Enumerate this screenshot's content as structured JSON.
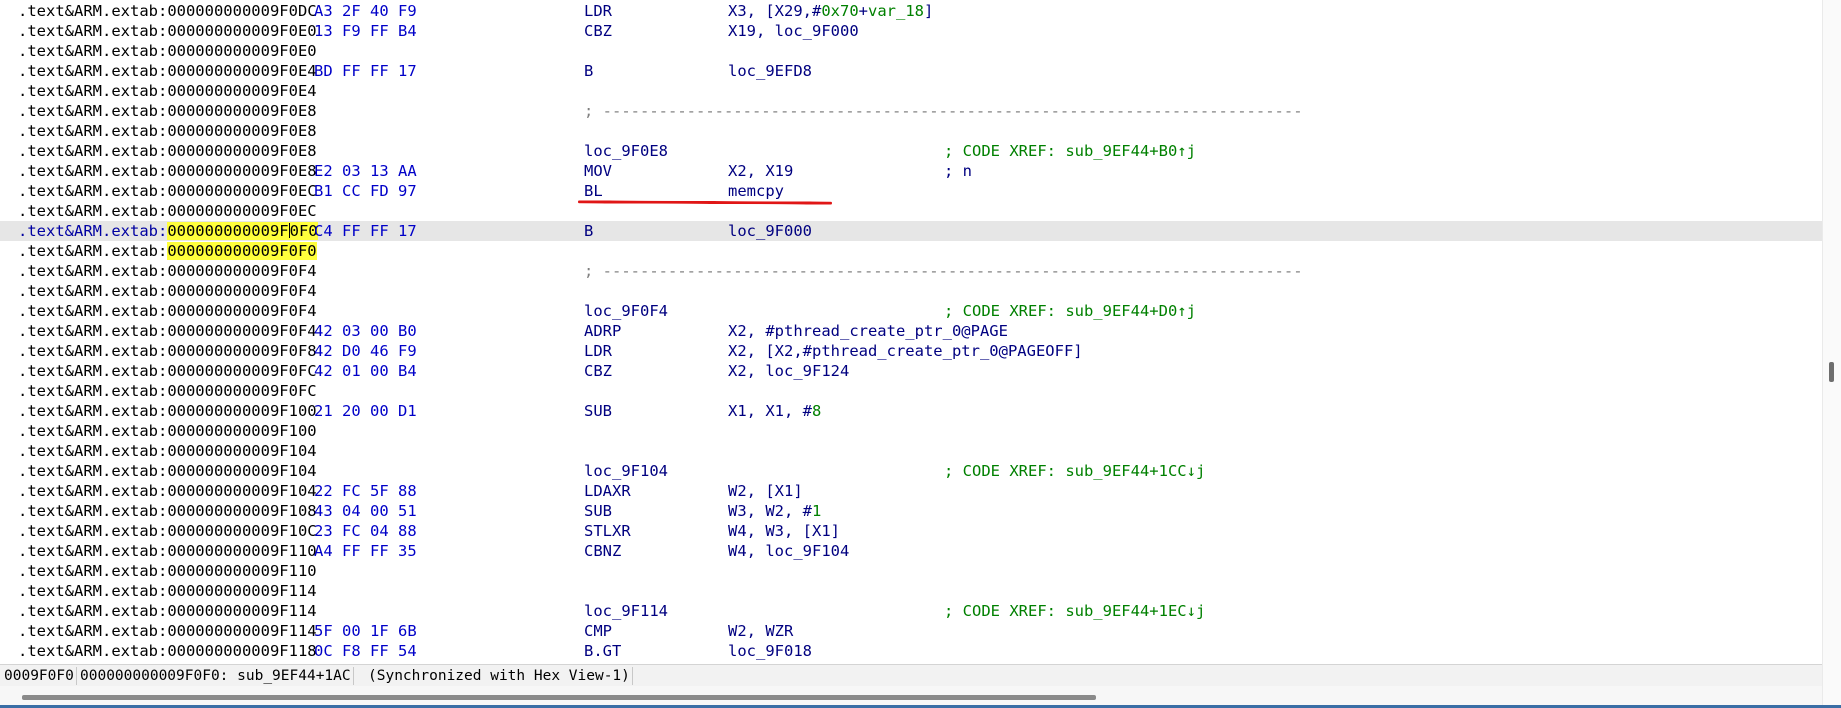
{
  "rows": [
    {
      "seg": ".text&ARM.extab:",
      "addr": "000000000009F0DC",
      "bytes": "A3 2F 40 F9",
      "mnem": "LDR",
      "ops": [
        "X3, [X29,#",
        "0x70",
        "+",
        "var_18",
        "]"
      ],
      "opsKinds": [
        "t",
        "n",
        "t",
        "n",
        "t"
      ],
      "cmt": ""
    },
    {
      "seg": ".text&ARM.extab:",
      "addr": "000000000009F0E0",
      "bytes": "13 F9 FF B4",
      "mnem": "CBZ",
      "ops": [
        "X19, loc_9F000"
      ],
      "opsKinds": [
        "t"
      ],
      "cmt": ""
    },
    {
      "seg": ".text&ARM.extab:",
      "addr": "000000000009F0E0",
      "bytes": "",
      "mnem": "",
      "ops": [],
      "opsKinds": [],
      "cmt": ""
    },
    {
      "seg": ".text&ARM.extab:",
      "addr": "000000000009F0E4",
      "bytes": "BD FF FF 17",
      "mnem": "B",
      "ops": [
        "loc_9EFD8"
      ],
      "opsKinds": [
        "t"
      ],
      "cmt": ""
    },
    {
      "seg": ".text&ARM.extab:",
      "addr": "000000000009F0E4",
      "bytes": "",
      "mnem": "",
      "ops": [],
      "opsKinds": [],
      "cmt": ""
    },
    {
      "seg": ".text&ARM.extab:",
      "addr": "000000000009F0E8",
      "bytes": "",
      "sep": "; ---------------------------------------------------------------------------",
      "mnem": "",
      "ops": [],
      "opsKinds": [],
      "cmt": ""
    },
    {
      "seg": ".text&ARM.extab:",
      "addr": "000000000009F0E8",
      "bytes": "",
      "mnem": "",
      "ops": [],
      "opsKinds": [],
      "cmt": ""
    },
    {
      "seg": ".text&ARM.extab:",
      "addr": "000000000009F0E8",
      "bytes": "",
      "mnem": "loc_9F0E8",
      "ops": [],
      "opsKinds": [],
      "cmt": "; CODE XREF: sub_9EF44+B0↑j"
    },
    {
      "seg": ".text&ARM.extab:",
      "addr": "000000000009F0E8",
      "bytes": "E2 03 13 AA",
      "mnem": "MOV",
      "ops": [
        "X2, X19"
      ],
      "opsKinds": [
        "t"
      ],
      "cmt": "; n",
      "cmtBlue": true
    },
    {
      "seg": ".text&ARM.extab:",
      "addr": "000000000009F0EC",
      "bytes": "B1 CC FD 97",
      "mnem": "BL",
      "ops": [
        "memcpy"
      ],
      "opsKinds": [
        "t"
      ],
      "cmt": ""
    },
    {
      "seg": ".text&ARM.extab:",
      "addr": "000000000009F0EC",
      "bytes": "",
      "mnem": "",
      "ops": [],
      "opsKinds": [],
      "cmt": ""
    },
    {
      "seg": ".text&ARM.extab:",
      "addr": "000000000009F0F0",
      "bytes": "C4 FF FF 17",
      "mnem": "B",
      "ops": [
        "loc_9F000"
      ],
      "opsKinds": [
        "t"
      ],
      "cmt": "",
      "current": true
    },
    {
      "seg": ".text&ARM.extab:",
      "addr": "000000000009F0F0",
      "bytes": "",
      "mnem": "",
      "ops": [],
      "opsKinds": [],
      "cmt": "",
      "highlight": true
    },
    {
      "seg": ".text&ARM.extab:",
      "addr": "000000000009F0F4",
      "bytes": "",
      "sep": "; ---------------------------------------------------------------------------",
      "mnem": "",
      "ops": [],
      "opsKinds": [],
      "cmt": ""
    },
    {
      "seg": ".text&ARM.extab:",
      "addr": "000000000009F0F4",
      "bytes": "",
      "mnem": "",
      "ops": [],
      "opsKinds": [],
      "cmt": ""
    },
    {
      "seg": ".text&ARM.extab:",
      "addr": "000000000009F0F4",
      "bytes": "",
      "mnem": "loc_9F0F4",
      "ops": [],
      "opsKinds": [],
      "cmt": "; CODE XREF: sub_9EF44+D0↑j"
    },
    {
      "seg": ".text&ARM.extab:",
      "addr": "000000000009F0F4",
      "bytes": "42 03 00 B0",
      "mnem": "ADRP",
      "ops": [
        "X2, #pthread_create_ptr_0@PAGE"
      ],
      "opsKinds": [
        "t"
      ],
      "cmt": ""
    },
    {
      "seg": ".text&ARM.extab:",
      "addr": "000000000009F0F8",
      "bytes": "42 D0 46 F9",
      "mnem": "LDR",
      "ops": [
        "X2, [X2,#pthread_create_ptr_0@PAGEOFF]"
      ],
      "opsKinds": [
        "t"
      ],
      "cmt": ""
    },
    {
      "seg": ".text&ARM.extab:",
      "addr": "000000000009F0FC",
      "bytes": "42 01 00 B4",
      "mnem": "CBZ",
      "ops": [
        "X2, loc_9F124"
      ],
      "opsKinds": [
        "t"
      ],
      "cmt": ""
    },
    {
      "seg": ".text&ARM.extab:",
      "addr": "000000000009F0FC",
      "bytes": "",
      "mnem": "",
      "ops": [],
      "opsKinds": [],
      "cmt": ""
    },
    {
      "seg": ".text&ARM.extab:",
      "addr": "000000000009F100",
      "bytes": "21 20 00 D1",
      "mnem": "SUB",
      "ops": [
        "X1, X1, #",
        "8"
      ],
      "opsKinds": [
        "t",
        "n"
      ],
      "cmt": ""
    },
    {
      "seg": ".text&ARM.extab:",
      "addr": "000000000009F100",
      "bytes": "",
      "mnem": "",
      "ops": [],
      "opsKinds": [],
      "cmt": ""
    },
    {
      "seg": ".text&ARM.extab:",
      "addr": "000000000009F104",
      "bytes": "",
      "mnem": "",
      "ops": [],
      "opsKinds": [],
      "cmt": ""
    },
    {
      "seg": ".text&ARM.extab:",
      "addr": "000000000009F104",
      "bytes": "",
      "mnem": "loc_9F104",
      "ops": [],
      "opsKinds": [],
      "cmt": "; CODE XREF: sub_9EF44+1CC↓j"
    },
    {
      "seg": ".text&ARM.extab:",
      "addr": "000000000009F104",
      "bytes": "22 FC 5F 88",
      "mnem": "LDAXR",
      "ops": [
        "W2, [X1]"
      ],
      "opsKinds": [
        "t"
      ],
      "cmt": ""
    },
    {
      "seg": ".text&ARM.extab:",
      "addr": "000000000009F108",
      "bytes": "43 04 00 51",
      "mnem": "SUB",
      "ops": [
        "W3, W2, #",
        "1"
      ],
      "opsKinds": [
        "t",
        "n"
      ],
      "cmt": ""
    },
    {
      "seg": ".text&ARM.extab:",
      "addr": "000000000009F10C",
      "bytes": "23 FC 04 88",
      "mnem": "STLXR",
      "ops": [
        "W4, W3, [X1]"
      ],
      "opsKinds": [
        "t"
      ],
      "cmt": ""
    },
    {
      "seg": ".text&ARM.extab:",
      "addr": "000000000009F110",
      "bytes": "A4 FF FF 35",
      "mnem": "CBNZ",
      "ops": [
        "W4, loc_9F104"
      ],
      "opsKinds": [
        "t"
      ],
      "cmt": ""
    },
    {
      "seg": ".text&ARM.extab:",
      "addr": "000000000009F110",
      "bytes": "",
      "mnem": "",
      "ops": [],
      "opsKinds": [],
      "cmt": ""
    },
    {
      "seg": ".text&ARM.extab:",
      "addr": "000000000009F114",
      "bytes": "",
      "mnem": "",
      "ops": [],
      "opsKinds": [],
      "cmt": ""
    },
    {
      "seg": ".text&ARM.extab:",
      "addr": "000000000009F114",
      "bytes": "",
      "mnem": "loc_9F114",
      "ops": [],
      "opsKinds": [],
      "cmt": "; CODE XREF: sub_9EF44+1EC↓j"
    },
    {
      "seg": ".text&ARM.extab:",
      "addr": "000000000009F114",
      "bytes": "5F 00 1F 6B",
      "mnem": "CMP",
      "ops": [
        "W2, WZR"
      ],
      "opsKinds": [
        "t"
      ],
      "cmt": ""
    },
    {
      "seg": ".text&ARM.extab:",
      "addr": "000000000009F118",
      "bytes": "0C F8 FF 54",
      "mnem": "B.GT",
      "ops": [
        "loc_9F018"
      ],
      "opsKinds": [
        "t"
      ],
      "cmt": ""
    }
  ],
  "status": {
    "offset": "0009F0F0",
    "location": "000000000009F0F0: sub_9EF44+1AC",
    "sync": "(Synchronized with Hex View-1)"
  },
  "colors": {
    "current_line_bg": "#e6e6e6",
    "highlight": "#ffff3c",
    "annotation_line": "#e01616",
    "comment": "#008000"
  }
}
